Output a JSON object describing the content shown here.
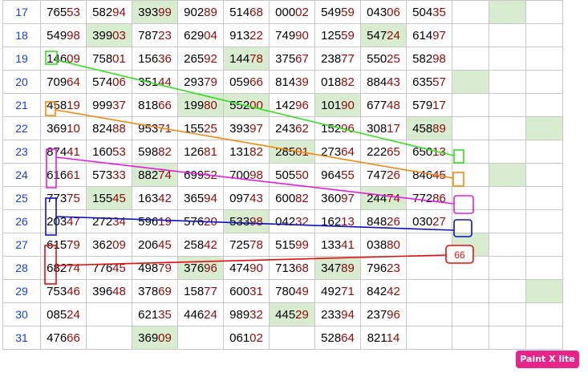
{
  "colors": {
    "highlight": "#d8eccf",
    "row_number": "#1a3fd0",
    "tail_digits": "#8b0d0d",
    "green_line": "#33dd22",
    "orange_line": "#ee8a10",
    "magenta_line": "#e020e0",
    "blue_line": "#1010c0",
    "red_line": "#e01010"
  },
  "annotation_label": "66",
  "watermark": "Paint X lite",
  "rows": [
    {
      "num": "17",
      "cells": [
        [
          "765",
          "53"
        ],
        [
          "582",
          "94"
        ],
        [
          "393",
          "99",
          "hl"
        ],
        [
          "902",
          "89"
        ],
        [
          "514",
          "68"
        ],
        [
          "000",
          "02"
        ],
        [
          "549",
          "59"
        ],
        [
          "043",
          "06"
        ],
        [
          "504",
          "35"
        ],
        null,
        [
          "",
          "",
          "hl"
        ],
        null
      ]
    },
    {
      "num": "18",
      "cells": [
        [
          "549",
          "98"
        ],
        [
          "399",
          "03",
          "hl"
        ],
        [
          "787",
          "23"
        ],
        [
          "629",
          "04"
        ],
        [
          "913",
          "22"
        ],
        [
          "749",
          "90"
        ],
        [
          "125",
          "59"
        ],
        [
          "547",
          "24",
          "hl"
        ],
        [
          "614",
          "97"
        ],
        null,
        null,
        null
      ]
    },
    {
      "num": "19",
      "cells": [
        [
          "146",
          "09"
        ],
        [
          "758",
          "01"
        ],
        [
          "156",
          "36"
        ],
        [
          "265",
          "92"
        ],
        [
          "144",
          "78",
          "hl"
        ],
        [
          "375",
          "67"
        ],
        [
          "238",
          "77"
        ],
        [
          "550",
          "25"
        ],
        [
          "582",
          "98"
        ],
        null,
        null,
        null
      ]
    },
    {
      "num": "20",
      "cells": [
        [
          "709",
          "64"
        ],
        [
          "574",
          "06"
        ],
        [
          "351",
          "44"
        ],
        [
          "293",
          "79"
        ],
        [
          "059",
          "66"
        ],
        [
          "814",
          "39"
        ],
        [
          "018",
          "82"
        ],
        [
          "884",
          "43"
        ],
        [
          "635",
          "57"
        ],
        [
          "",
          "",
          "hl"
        ],
        null,
        null
      ]
    },
    {
      "num": "21",
      "cells": [
        [
          "458",
          "19"
        ],
        [
          "999",
          "37"
        ],
        [
          "818",
          "66"
        ],
        [
          "199",
          "80",
          "hl"
        ],
        [
          "552",
          "00",
          "hl"
        ],
        [
          "142",
          "96"
        ],
        [
          "101",
          "90",
          "hl"
        ],
        [
          "677",
          "48"
        ],
        [
          "579",
          "17"
        ],
        null,
        null,
        null
      ]
    },
    {
      "num": "22",
      "cells": [
        [
          "369",
          "10"
        ],
        [
          "824",
          "88"
        ],
        [
          "953",
          "71"
        ],
        [
          "155",
          "25"
        ],
        [
          "393",
          "97"
        ],
        [
          "243",
          "62"
        ],
        [
          "152",
          "96"
        ],
        [
          "308",
          "17"
        ],
        [
          "458",
          "89",
          "hl"
        ],
        null,
        null,
        [
          "",
          "",
          "hl"
        ]
      ]
    },
    {
      "num": "23",
      "cells": [
        [
          "874",
          "41"
        ],
        [
          "160",
          "53"
        ],
        [
          "598",
          "82"
        ],
        [
          "126",
          "81"
        ],
        [
          "131",
          "82"
        ],
        [
          "285",
          "01",
          "hl"
        ],
        [
          "273",
          "64"
        ],
        [
          "222",
          "65"
        ],
        [
          "650",
          "13"
        ],
        null,
        null,
        null
      ]
    },
    {
      "num": "24",
      "cells": [
        [
          "616",
          "61"
        ],
        [
          "573",
          "33"
        ],
        [
          "882",
          "74",
          "hl"
        ],
        [
          "699",
          "52"
        ],
        [
          "700",
          "98"
        ],
        [
          "505",
          "50"
        ],
        [
          "964",
          "55"
        ],
        [
          "747",
          "26"
        ],
        [
          "846",
          "45"
        ],
        null,
        [
          "",
          "",
          "hl"
        ],
        null
      ]
    },
    {
      "num": "25",
      "cells": [
        [
          "773",
          "75"
        ],
        [
          "155",
          "45",
          "hl"
        ],
        [
          "163",
          "42"
        ],
        [
          "365",
          "94"
        ],
        [
          "097",
          "43"
        ],
        [
          "600",
          "82"
        ],
        [
          "360",
          "97"
        ],
        [
          "244",
          "74",
          "hl"
        ],
        [
          "772",
          "86"
        ],
        null,
        null,
        null
      ]
    },
    {
      "num": "26",
      "cells": [
        [
          "203",
          "47"
        ],
        [
          "272",
          "34"
        ],
        [
          "596",
          "19"
        ],
        [
          "576",
          "20"
        ],
        [
          "533",
          "98",
          "hl"
        ],
        [
          "042",
          "32"
        ],
        [
          "162",
          "13"
        ],
        [
          "848",
          "26"
        ],
        [
          "030",
          "27"
        ],
        null,
        null,
        null
      ]
    },
    {
      "num": "27",
      "cells": [
        [
          "615",
          "79"
        ],
        [
          "362",
          "09"
        ],
        [
          "206",
          "45"
        ],
        [
          "258",
          "42"
        ],
        [
          "725",
          "78"
        ],
        [
          "515",
          "99"
        ],
        [
          "133",
          "41"
        ],
        [
          "038",
          "80"
        ],
        null,
        [
          "",
          "",
          "hl"
        ],
        null,
        null
      ]
    },
    {
      "num": "28",
      "cells": [
        [
          "682",
          "74"
        ],
        [
          "776",
          "45"
        ],
        [
          "498",
          "79"
        ],
        [
          "376",
          "96",
          "hl"
        ],
        [
          "474",
          "90"
        ],
        [
          "713",
          "68"
        ],
        [
          "347",
          "89",
          "hl"
        ],
        [
          "796",
          "23"
        ],
        null,
        null,
        null,
        null
      ]
    },
    {
      "num": "29",
      "cells": [
        [
          "753",
          "46"
        ],
        [
          "396",
          "48"
        ],
        [
          "378",
          "69"
        ],
        [
          "158",
          "77"
        ],
        [
          "600",
          "31"
        ],
        [
          "780",
          "49"
        ],
        [
          "492",
          "71"
        ],
        [
          "842",
          "42"
        ],
        null,
        null,
        null,
        [
          "",
          "",
          "hl"
        ]
      ]
    },
    {
      "num": "30",
      "cells": [
        [
          "085",
          "24"
        ],
        null,
        [
          "621",
          "35"
        ],
        [
          "446",
          "24"
        ],
        [
          "989",
          "32"
        ],
        [
          "445",
          "29",
          "hl"
        ],
        [
          "233",
          "94"
        ],
        [
          "237",
          "96"
        ],
        null,
        null,
        null,
        null
      ]
    },
    {
      "num": "31",
      "cells": [
        [
          "476",
          "66"
        ],
        null,
        [
          "369",
          "09",
          "hl"
        ],
        null,
        [
          "061",
          "02"
        ],
        null,
        [
          "528",
          "64"
        ],
        [
          "821",
          "14"
        ],
        null,
        null,
        null,
        null
      ]
    }
  ]
}
